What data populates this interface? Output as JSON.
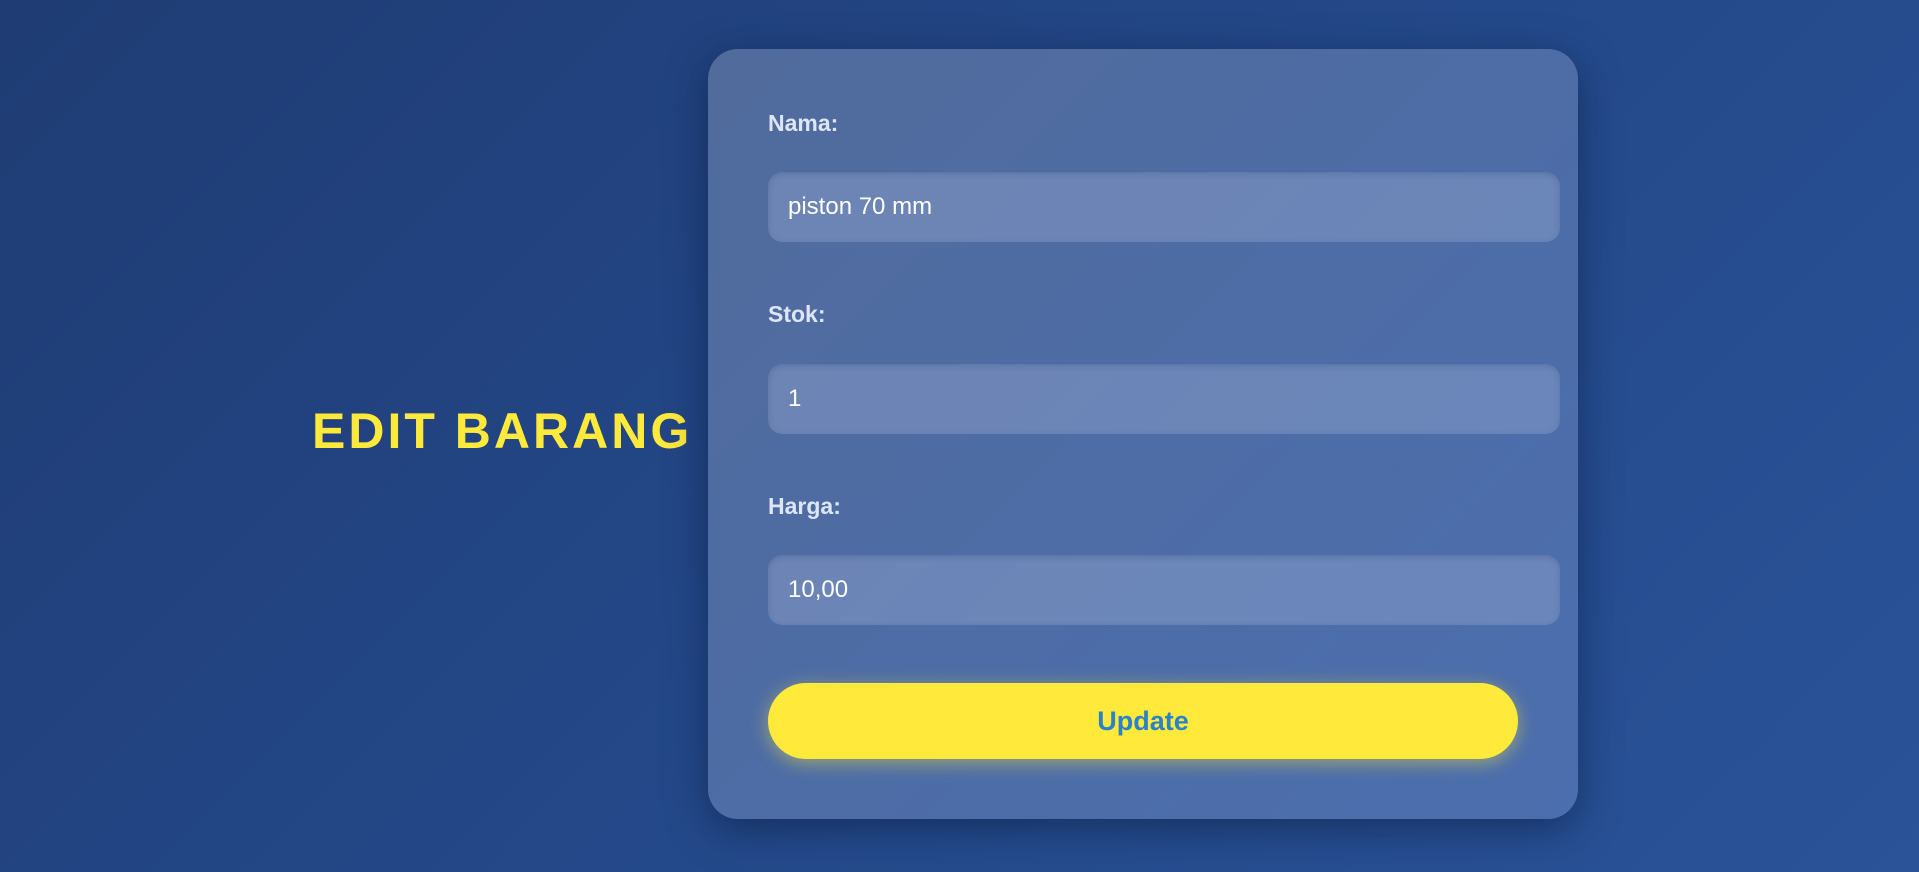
{
  "page": {
    "title": "EDIT BARANG"
  },
  "form": {
    "fields": [
      {
        "label": "Nama:",
        "value": "piston 70 mm"
      },
      {
        "label": "Stok:",
        "value": "1"
      },
      {
        "label": "Harga:",
        "value": "10,00"
      }
    ],
    "submit_label": "Update"
  },
  "colors": {
    "accent": "#ffea3b",
    "button_text": "#2a82c9",
    "background": "#24498a"
  }
}
